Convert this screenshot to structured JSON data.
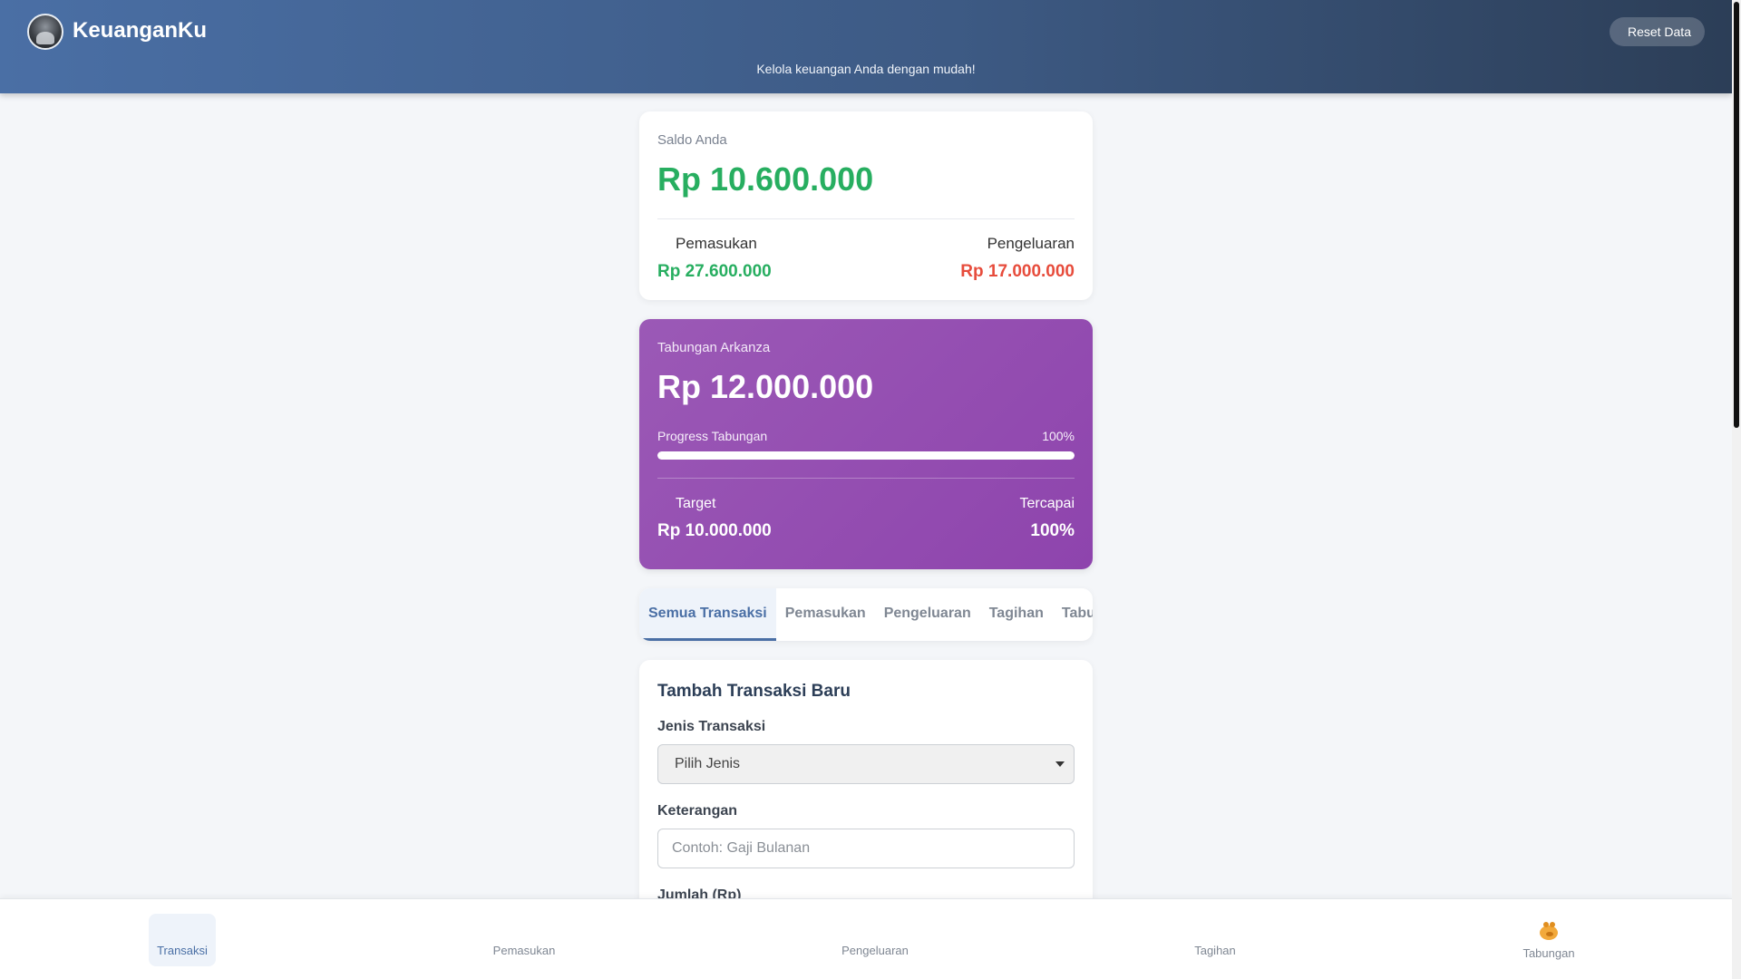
{
  "header": {
    "app_title": "KeuanganKu",
    "subtitle": "Kelola keuangan Anda dengan mudah!",
    "reset_label": "Reset Data",
    "reset_icon": "trash-icon",
    "gradient_colors": [
      "#4a6fa5",
      "#2c3e57"
    ]
  },
  "balance": {
    "label": "Saldo Anda",
    "value": "Rp 10.600.000",
    "income_label": "Pemasukan",
    "income_value": "Rp 27.600.000",
    "expense_label": "Pengeluaran",
    "expense_value": "Rp 17.000.000",
    "income_color": "#27ae60",
    "expense_color": "#e74c3c"
  },
  "savings": {
    "label": "Tabungan Arkanza",
    "value": "Rp 12.000.000",
    "progress_label": "Progress Tabungan",
    "progress_text": "100%",
    "progress_fraction": 1.0,
    "target_label": "Target",
    "target_value": "Rp 10.000.000",
    "achieved_label": "Tercapai",
    "achieved_value": "100%",
    "card_color": "#9b59b6"
  },
  "tabs": [
    {
      "label": "Semua Transaksi",
      "active": true
    },
    {
      "label": "Pemasukan",
      "active": false
    },
    {
      "label": "Pengeluaran",
      "active": false
    },
    {
      "label": "Tagihan",
      "active": false
    },
    {
      "label": "Tabungan",
      "active": false
    }
  ],
  "form": {
    "title": "Tambah Transaksi Baru",
    "type_label": "Jenis Transaksi",
    "type_selected": "Pilih Jenis",
    "desc_label": "Keterangan",
    "desc_placeholder": "Contoh: Gaji Bulanan",
    "amount_label": "Jumlah (Rp)"
  },
  "bottom_nav": [
    {
      "label": "Transaksi",
      "icon": "exchange-icon",
      "active": true
    },
    {
      "label": "Pemasukan",
      "icon": "arrow-down-icon",
      "active": false
    },
    {
      "label": "Pengeluaran",
      "icon": "arrow-up-icon",
      "active": false
    },
    {
      "label": "Tagihan",
      "icon": "receipt-icon",
      "active": false
    },
    {
      "label": "Tabungan",
      "icon": "piggy-bank-icon",
      "active": false
    }
  ]
}
